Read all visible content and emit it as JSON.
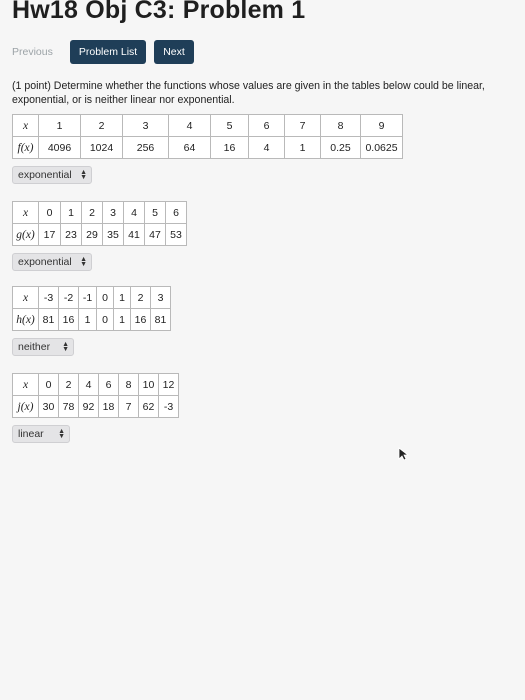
{
  "page": {
    "title": "Hw18 Obj C3: Problem 1"
  },
  "nav": {
    "previous": "Previous",
    "problem_list": "Problem List",
    "next": "Next"
  },
  "prompt": "(1 point) Determine whether the functions whose values are given in the tables below could be linear, exponential, or is neither linear nor exponential.",
  "tables": [
    {
      "rows": [
        [
          "x",
          "1",
          "2",
          "3",
          "4",
          "5",
          "6",
          "7",
          "8",
          "9"
        ],
        [
          "f(x)",
          "4096",
          "1024",
          "256",
          "64",
          "16",
          "4",
          "1",
          "0.25",
          "0.0625"
        ]
      ],
      "answer": "exponential"
    },
    {
      "rows": [
        [
          "x",
          "0",
          "1",
          "2",
          "3",
          "4",
          "5",
          "6"
        ],
        [
          "g(x)",
          "17",
          "23",
          "29",
          "35",
          "41",
          "47",
          "53"
        ]
      ],
      "answer": "exponential"
    },
    {
      "rows": [
        [
          "x",
          "-3",
          "-2",
          "-1",
          "0",
          "1",
          "2",
          "3"
        ],
        [
          "h(x)",
          "81",
          "16",
          "1",
          "0",
          "1",
          "16",
          "81"
        ]
      ],
      "answer": "neither"
    },
    {
      "rows": [
        [
          "x",
          "0",
          "2",
          "4",
          "6",
          "8",
          "10",
          "12"
        ],
        [
          "j(x)",
          "30",
          "78",
          "92",
          "18",
          "7",
          "62",
          "-3"
        ]
      ],
      "answer": "linear"
    }
  ],
  "icons": {
    "select_arrows": "updown-arrows-icon",
    "pointer": "mouse-pointer-icon"
  }
}
